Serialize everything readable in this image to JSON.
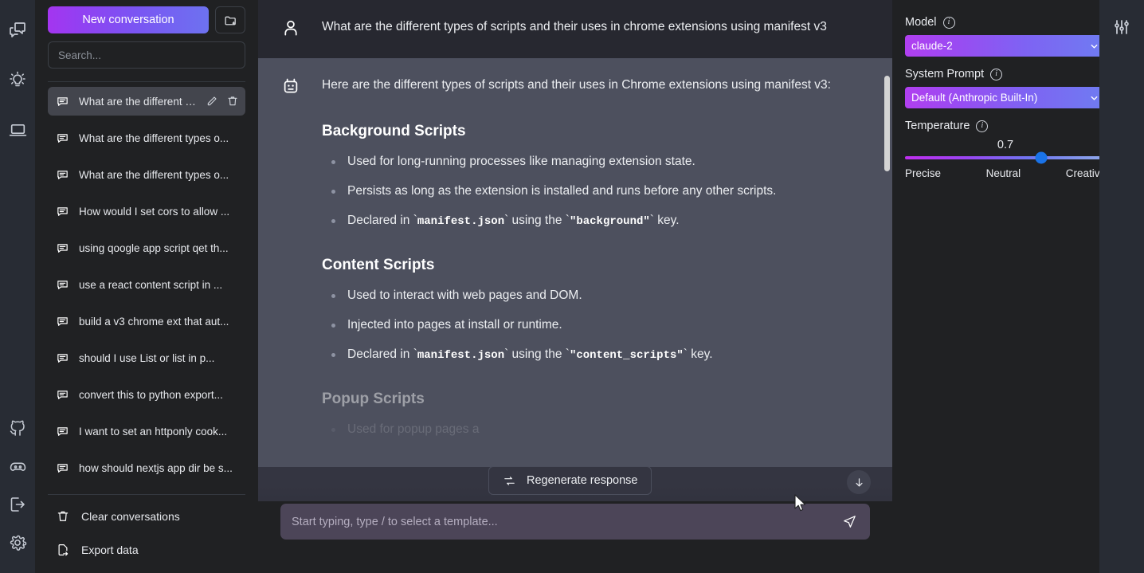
{
  "rail": {
    "top_icons": [
      {
        "name": "conversations-icon",
        "title": "Conversations"
      },
      {
        "name": "prompts-lightbulb-icon",
        "title": "Prompts"
      },
      {
        "name": "screen-laptop-icon",
        "title": "Screen"
      }
    ],
    "bottom_icons": [
      {
        "name": "github-icon",
        "title": "GitHub"
      },
      {
        "name": "discord-icon",
        "title": "Discord"
      },
      {
        "name": "logout-icon",
        "title": "Log out"
      },
      {
        "name": "settings-gear-icon",
        "title": "Settings"
      }
    ]
  },
  "sidebar": {
    "new_conversation_label": "New conversation",
    "new_folder_icon": "folder-plus-icon",
    "search": {
      "placeholder": "Search...",
      "value": ""
    },
    "conversations": [
      {
        "label": "What are the different ty...",
        "active": true
      },
      {
        "label": "What are the different types o...",
        "active": false
      },
      {
        "label": "What are the different types o...",
        "active": false
      },
      {
        "label": "How would I set cors to allow ...",
        "active": false
      },
      {
        "label": "using qoogle app script qet th...",
        "active": false
      },
      {
        "label": "use a react content script in ...",
        "active": false
      },
      {
        "label": "build a v3 chrome ext that aut...",
        "active": false
      },
      {
        "label": "should I use List or list in p...",
        "active": false
      },
      {
        "label": "convert this to python export...",
        "active": false
      },
      {
        "label": "I want to set an httponly cook...",
        "active": false
      },
      {
        "label": "how should nextjs app dir be s...",
        "active": false
      }
    ],
    "footer_links": [
      {
        "label": "Clear conversations",
        "icon": "trash-icon"
      },
      {
        "label": "Export data",
        "icon": "export-file-icon"
      }
    ]
  },
  "chat": {
    "user_message": "What are the different types of scripts and their uses in chrome extensions using manifest v3",
    "assistant_intro": "Here are the different types of scripts and their uses in Chrome extensions using manifest v3:",
    "sections": [
      {
        "heading": "Background Scripts",
        "bullets": [
          {
            "pre": "Used for long-running processes like managing extension state.",
            "code1": "",
            "mid": "",
            "code2": "",
            "post": ""
          },
          {
            "pre": "Persists as long as the extension is installed and runs before any other scripts.",
            "code1": "",
            "mid": "",
            "code2": "",
            "post": ""
          },
          {
            "pre": "Declared in `",
            "code1": "manifest.json",
            "mid": "` using the `",
            "code2": "\"background\"",
            "post": "` key."
          }
        ]
      },
      {
        "heading": "Content Scripts",
        "bullets": [
          {
            "pre": "Used to interact with web pages and DOM.",
            "code1": "",
            "mid": "",
            "code2": "",
            "post": ""
          },
          {
            "pre": "Injected into pages at install or runtime.",
            "code1": "",
            "mid": "",
            "code2": "",
            "post": ""
          },
          {
            "pre": "Declared in `",
            "code1": "manifest.json",
            "mid": "` using the `",
            "code2": "\"content_scripts\"",
            "post": "` key."
          }
        ]
      },
      {
        "heading": "Popup Scripts",
        "bullets": [
          {
            "pre": "Used for popup pages a",
            "code1": "",
            "mid": "",
            "code2": "",
            "post": ""
          }
        ]
      }
    ],
    "regenerate_label": "Regenerate response",
    "scroll_down_icon": "arrow-down-icon",
    "composer": {
      "placeholder": "Start typing, type / to select a template...",
      "value": "",
      "send_icon": "send-plane-icon"
    }
  },
  "settings": {
    "model": {
      "label": "Model",
      "value": "claude-2",
      "options": [
        "claude-2"
      ]
    },
    "system_prompt": {
      "label": "System Prompt",
      "value": "Default (Anthropic Built-In)",
      "options": [
        "Default (Anthropic Built-In)"
      ]
    },
    "temperature": {
      "label": "Temperature",
      "value": "0.7",
      "percent": 68,
      "min_label": "Precise",
      "mid_label": "Neutral",
      "max_label": "Creative"
    },
    "toggle_icon": "sliders-icon",
    "info_icon_char": "i"
  },
  "colors": {
    "accent_start": "#a435f0",
    "accent_end": "#6d72f0",
    "slider_thumb": "#1a73e8",
    "sidebar_bg": "#202123",
    "chat_bg": "#343541",
    "assistant_bg": "#4d505e",
    "user_bg": "#272830"
  }
}
